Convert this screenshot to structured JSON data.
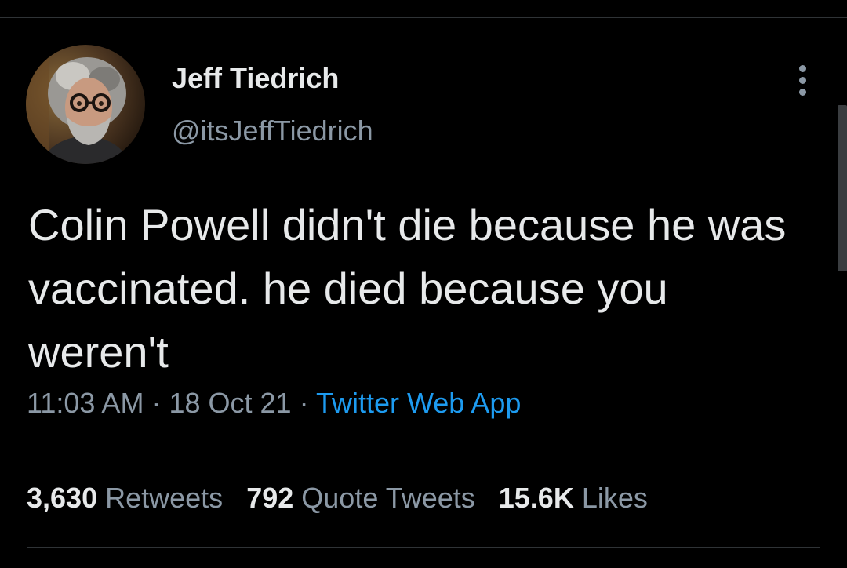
{
  "tweet": {
    "author": {
      "display_name": "Jeff Tiedrich",
      "handle": "@itsJeffTiedrich"
    },
    "text": "Colin Powell didn't die because he was vaccinated. he died because you weren't",
    "time": "11:03 AM",
    "separator": "·",
    "date": "18 Oct 21",
    "source": "Twitter Web App",
    "stats": {
      "retweets": {
        "count": "3,630",
        "label": "Retweets"
      },
      "quote_tweets": {
        "count": "792",
        "label": "Quote Tweets"
      },
      "likes": {
        "count": "15.6K",
        "label": "Likes"
      }
    }
  },
  "icons": {
    "more": "more-vertical-icon"
  },
  "colors": {
    "background": "#000000",
    "primary_text": "#e7e9ea",
    "secondary_text": "#8b98a5",
    "link": "#1d9bf0",
    "divider": "#2f3336"
  }
}
